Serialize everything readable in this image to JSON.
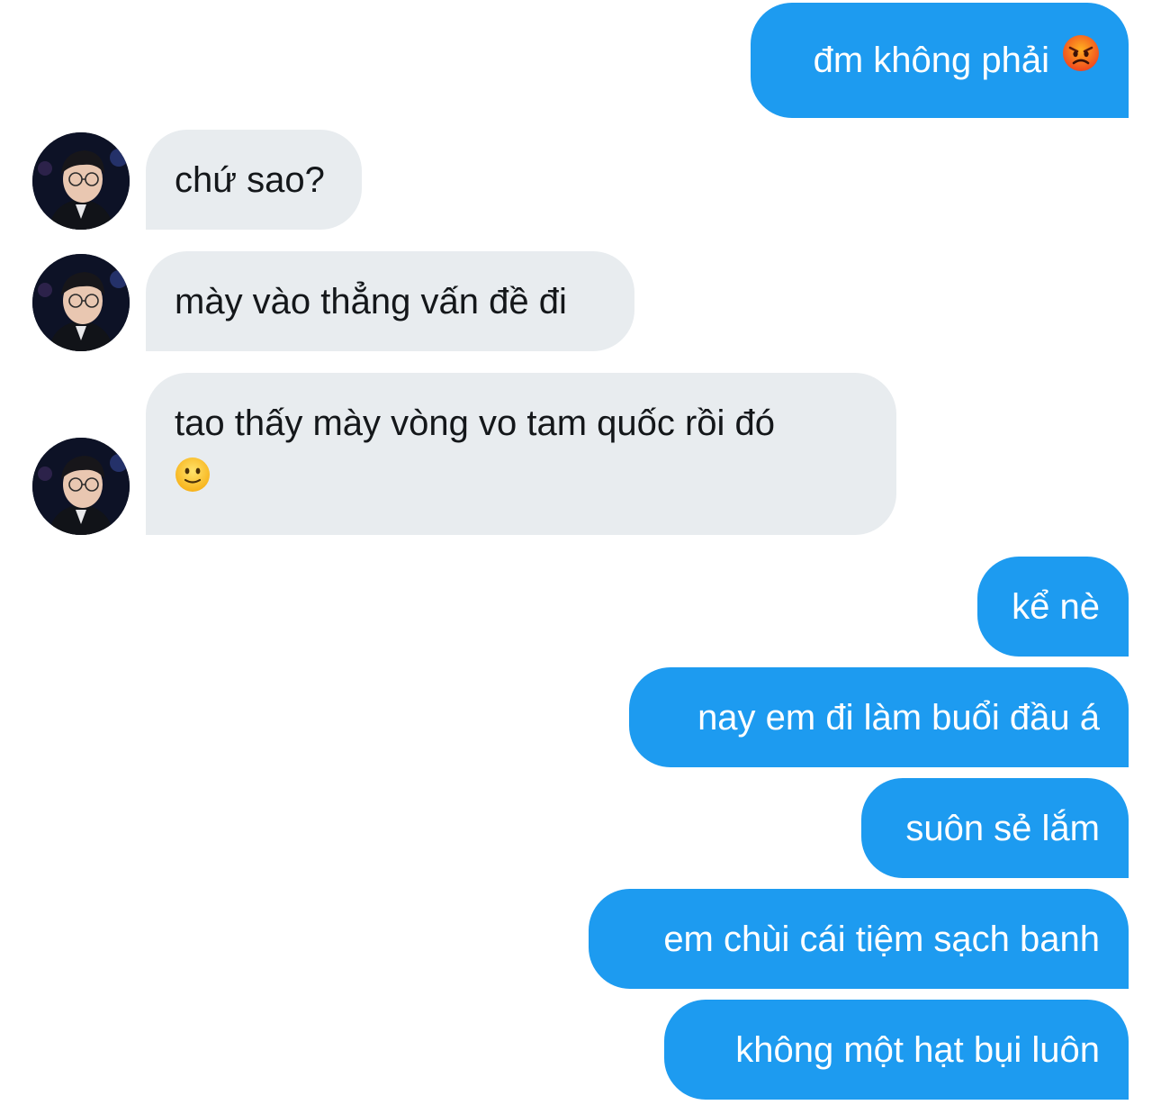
{
  "conversation": {
    "messages": [
      {
        "side": "sent",
        "text": "đm không phải",
        "emoji": "angry-face"
      },
      {
        "side": "received",
        "text": "chứ sao?"
      },
      {
        "side": "received",
        "text": "mày vào thẳng vấn đề đi"
      },
      {
        "side": "received",
        "text": "tao thấy mày vòng vo tam quốc rồi đó",
        "emoji": "slightly-smiling-face"
      },
      {
        "side": "sent",
        "text": "kể nè"
      },
      {
        "side": "sent",
        "text": "nay em đi làm buổi đầu á"
      },
      {
        "side": "sent",
        "text": "suôn sẻ lắm"
      },
      {
        "side": "sent",
        "text": "em chùi cái tiệm sạch banh"
      },
      {
        "side": "sent",
        "text": "không một hạt bụi luôn"
      }
    ]
  },
  "colors": {
    "sent_bubble": "#1d9bf0",
    "received_bubble": "#e8ecef",
    "sent_text": "#ffffff",
    "received_text": "#14171a"
  }
}
